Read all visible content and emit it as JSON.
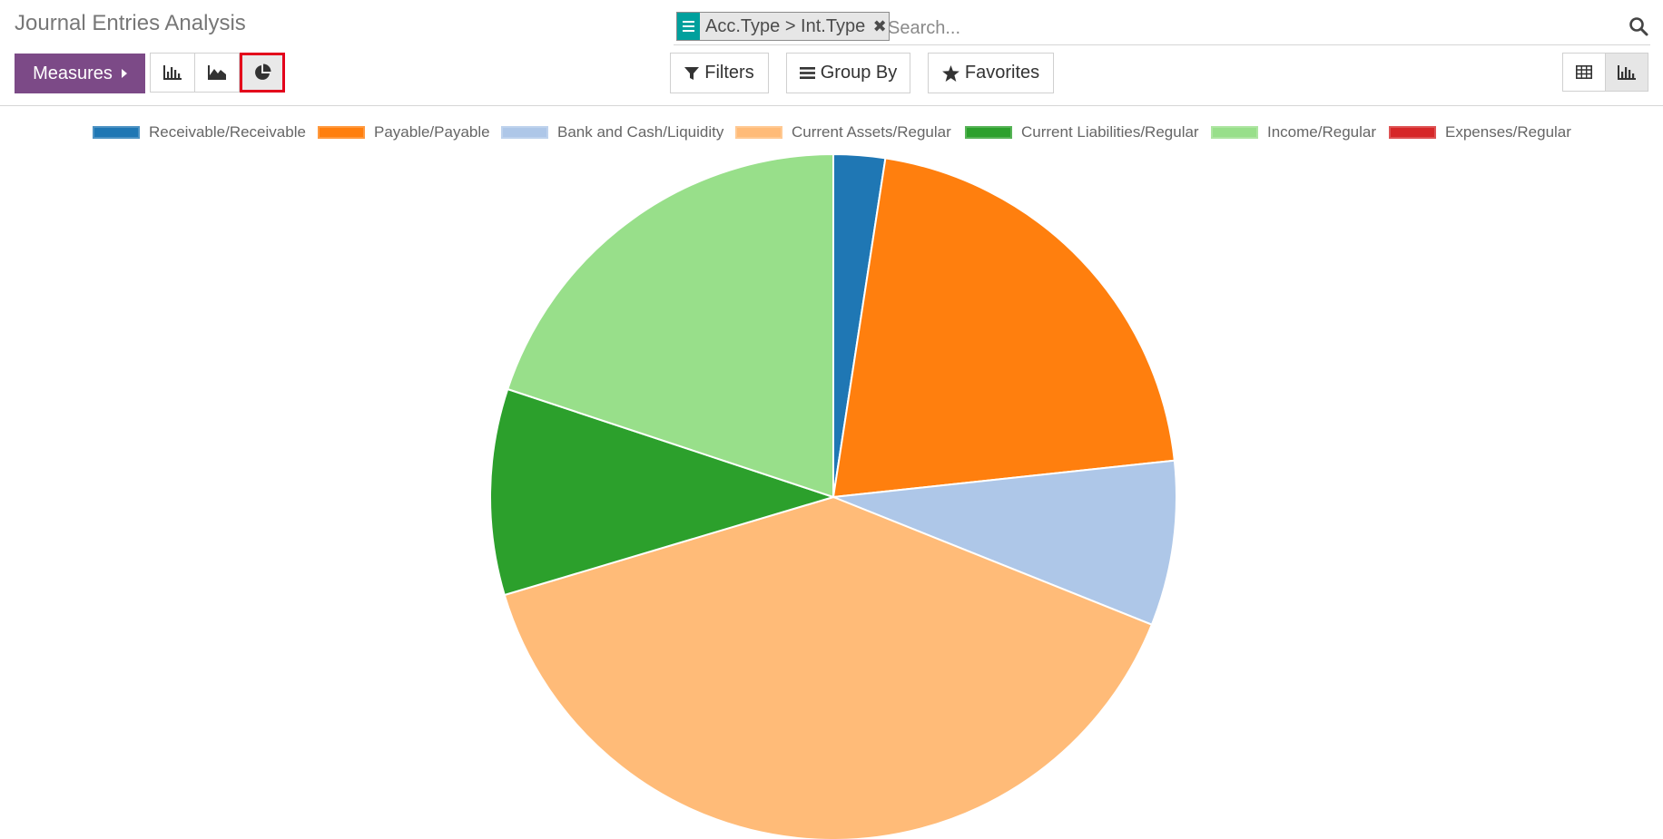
{
  "page": {
    "title": "Journal Entries Analysis"
  },
  "search": {
    "facet_value": "Acc.Type > Int.Type",
    "placeholder": "Search..."
  },
  "toolbar": {
    "measures_label": "Measures",
    "filters_label": "Filters",
    "groupby_label": "Group By",
    "favorites_label": "Favorites",
    "chart_modes": [
      {
        "name": "bar-chart-icon",
        "active": false
      },
      {
        "name": "line-chart-icon",
        "active": false
      },
      {
        "name": "pie-chart-icon",
        "active": true
      }
    ],
    "views": [
      {
        "name": "pivot-view-icon",
        "active": false
      },
      {
        "name": "graph-view-icon",
        "active": true
      }
    ]
  },
  "colors": {
    "brand": "#7c4a87",
    "facet_accent": "#00a09d",
    "highlight": "#e3001b"
  },
  "chart_data": {
    "type": "pie",
    "labels": [
      "Receivable/Receivable",
      "Payable/Payable",
      "Bank and Cash/Liquidity",
      "Current Assets/Regular",
      "Current Liabilities/Regular",
      "Income/Regular",
      "Expenses/Regular"
    ],
    "values": [
      2.5,
      21.5,
      8.0,
      40.5,
      10.0,
      20.5,
      0
    ],
    "colors": [
      "#1f77b4",
      "#ff7f0e",
      "#aec7e8",
      "#ffbb78",
      "#2ca02c",
      "#98df8a",
      "#d62728"
    ],
    "legend_position": "top",
    "start_angle": "top, clockwise"
  }
}
